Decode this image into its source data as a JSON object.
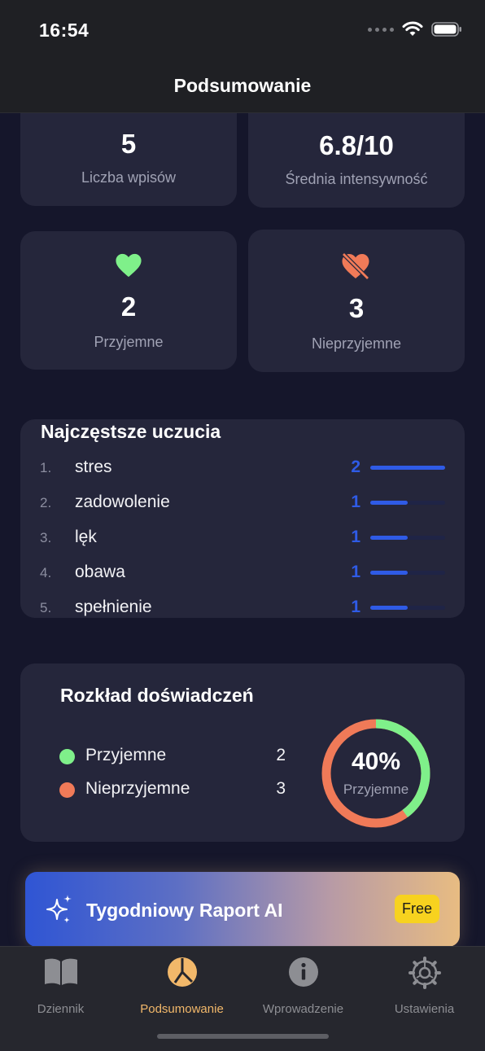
{
  "status": {
    "time": "16:54"
  },
  "nav": {
    "title": "Podsumowanie"
  },
  "stats": [
    {
      "value": "5",
      "label": "Liczba wpisów"
    },
    {
      "value": "6.8/10",
      "label": "Średnia intensywność"
    },
    {
      "value": "2",
      "label": "Przyjemne",
      "icon": "heart-icon"
    },
    {
      "value": "3",
      "label": "Nieprzyjemne",
      "icon": "heart-slash-icon"
    }
  ],
  "feelings": {
    "title": "Najczęstsze uczucia",
    "items": [
      {
        "rank": "1.",
        "name": "stres",
        "count": "2",
        "share": 1.0
      },
      {
        "rank": "2.",
        "name": "zadowolenie",
        "count": "1",
        "share": 0.5
      },
      {
        "rank": "3.",
        "name": "lęk",
        "count": "1",
        "share": 0.5
      },
      {
        "rank": "4.",
        "name": "obawa",
        "count": "1",
        "share": 0.5
      },
      {
        "rank": "5.",
        "name": "spełnienie",
        "count": "1",
        "share": 0.5
      }
    ]
  },
  "distribution": {
    "title": "Rozkład doświadczeń",
    "legend": [
      {
        "label": "Przyjemne",
        "value": "2",
        "color": "#7ff08a"
      },
      {
        "label": "Nieprzyjemne",
        "value": "3",
        "color": "#f07a58"
      }
    ],
    "percent": "40%",
    "percent_label": "Przyjemne",
    "pleasant_fraction": 0.4
  },
  "banner": {
    "title": "Tygodniowy Raport AI",
    "badge": "Free",
    "icon": "sparkles-icon"
  },
  "tabs": [
    {
      "label": "Dziennik",
      "icon": "book-icon",
      "active": false
    },
    {
      "label": "Podsumowanie",
      "icon": "pie-chart-icon",
      "active": true
    },
    {
      "label": "Wprowadzenie",
      "icon": "info-icon",
      "active": false
    },
    {
      "label": "Ustawienia",
      "icon": "gear-icon",
      "active": false
    }
  ],
  "colors": {
    "accent": "#2f5be6",
    "pleasant": "#7ff08a",
    "unpleasant": "#f07a58",
    "active_tab": "#f2b86a",
    "badge": "#f7d21f"
  }
}
